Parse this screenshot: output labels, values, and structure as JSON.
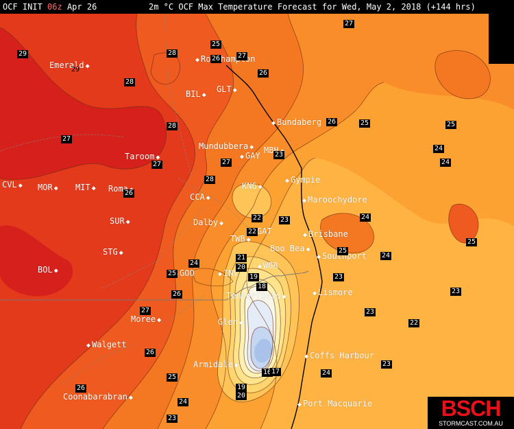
{
  "header": {
    "model": "OCF INIT",
    "run": "06z",
    "date": "Apr 26",
    "title": "2m °C OCF Max Temperature Forecast for Wed, May 2, 2018 (+144 hrs)"
  },
  "logo": {
    "text": "BSCH",
    "site": "STORMCAST.COM.AU"
  },
  "places": [
    {
      "id": "emerald",
      "name": "Emerald",
      "side": "left"
    },
    {
      "id": "rockhampton",
      "name": "Rockhampton",
      "side": "right"
    },
    {
      "id": "bil",
      "name": "BIL",
      "side": "left"
    },
    {
      "id": "glt",
      "name": "GLT",
      "side": "left"
    },
    {
      "id": "bundaberg",
      "name": "Bundaberg",
      "side": "right"
    },
    {
      "id": "mundubbera",
      "name": "Mundubbera",
      "side": "left"
    },
    {
      "id": "gay",
      "name": "GAY",
      "side": "right"
    },
    {
      "id": "mbh",
      "name": "MBH",
      "side": "left"
    },
    {
      "id": "taroom",
      "name": "Taroom",
      "side": "left"
    },
    {
      "id": "gympie",
      "name": "Gympie",
      "side": "right"
    },
    {
      "id": "kng",
      "name": "KNG",
      "side": "left"
    },
    {
      "id": "cvl",
      "name": "CVL",
      "side": "left"
    },
    {
      "id": "mor",
      "name": "MOR",
      "side": "left"
    },
    {
      "id": "mit",
      "name": "MIT",
      "side": "left"
    },
    {
      "id": "roma",
      "name": "Roma",
      "side": "left"
    },
    {
      "id": "cca",
      "name": "CCA",
      "side": "left"
    },
    {
      "id": "maroochydore",
      "name": "Maroochydore",
      "side": "right"
    },
    {
      "id": "sur",
      "name": "SUR",
      "side": "left"
    },
    {
      "id": "dalby",
      "name": "Dalby",
      "side": "left"
    },
    {
      "id": "gat",
      "name": "GAT",
      "side": "right"
    },
    {
      "id": "brisbane",
      "name": "Brisbane",
      "side": "right"
    },
    {
      "id": "twb",
      "name": "TWB",
      "side": "left"
    },
    {
      "id": "boobea",
      "name": "Boo Bea",
      "side": "left"
    },
    {
      "id": "stg",
      "name": "STG",
      "side": "left"
    },
    {
      "id": "southport",
      "name": "Southport",
      "side": "right"
    },
    {
      "id": "bol",
      "name": "BOL",
      "side": "left"
    },
    {
      "id": "goo",
      "name": "GOO",
      "side": "right"
    },
    {
      "id": "wor",
      "name": "WOR",
      "side": "right"
    },
    {
      "id": "inv",
      "name": "INV",
      "side": "right"
    },
    {
      "id": "tenterfield",
      "name": "Tenterfield",
      "side": "left"
    },
    {
      "id": "lismore",
      "name": "Lismore",
      "side": "right"
    },
    {
      "id": "moree",
      "name": "Moree",
      "side": "left"
    },
    {
      "id": "glen",
      "name": "Glen",
      "side": "left"
    },
    {
      "id": "walgett",
      "name": "Walgett",
      "side": "right"
    },
    {
      "id": "armidale",
      "name": "Armidale",
      "side": "left"
    },
    {
      "id": "coffsharbour",
      "name": "Coffs Harbour",
      "side": "right"
    },
    {
      "id": "coonabarabran",
      "name": "Coonabarabran",
      "side": "left"
    },
    {
      "id": "portmacquarie",
      "name": "Port Macquarie",
      "side": "right"
    }
  ],
  "labels": [
    {
      "v": "27",
      "style": "box"
    },
    {
      "v": "29",
      "style": "box"
    },
    {
      "v": "29",
      "style": "plain"
    },
    {
      "v": "28",
      "style": "box"
    },
    {
      "v": "25",
      "style": "box"
    },
    {
      "v": "27",
      "style": "box"
    },
    {
      "v": "26",
      "style": "box"
    },
    {
      "v": "26",
      "style": "box"
    },
    {
      "v": "28",
      "style": "box"
    },
    {
      "v": "28",
      "style": "box"
    },
    {
      "v": "26",
      "style": "box"
    },
    {
      "v": "25",
      "style": "box"
    },
    {
      "v": "25",
      "style": "box"
    },
    {
      "v": "27",
      "style": "box"
    },
    {
      "v": "24",
      "style": "box"
    },
    {
      "v": "24",
      "style": "box"
    },
    {
      "v": "27",
      "style": "box"
    },
    {
      "v": "27",
      "style": "box"
    },
    {
      "v": "23",
      "style": "box"
    },
    {
      "v": "26",
      "style": "box"
    },
    {
      "v": "28",
      "style": "box"
    },
    {
      "v": "22",
      "style": "box"
    },
    {
      "v": "23",
      "style": "box"
    },
    {
      "v": "24",
      "style": "box"
    },
    {
      "v": "25",
      "style": "box"
    },
    {
      "v": "22",
      "style": "box"
    },
    {
      "v": "21",
      "style": "box"
    },
    {
      "v": "25",
      "style": "box"
    },
    {
      "v": "24",
      "style": "box"
    },
    {
      "v": "24",
      "style": "box"
    },
    {
      "v": "20",
      "style": "box"
    },
    {
      "v": "25",
      "style": "box"
    },
    {
      "v": "19",
      "style": "box"
    },
    {
      "v": "23",
      "style": "box"
    },
    {
      "v": "26",
      "style": "box"
    },
    {
      "v": "18",
      "style": "box"
    },
    {
      "v": "23",
      "style": "box"
    },
    {
      "v": "23",
      "style": "box"
    },
    {
      "v": "27",
      "style": "box"
    },
    {
      "v": "22",
      "style": "box"
    },
    {
      "v": "26",
      "style": "box"
    },
    {
      "v": "16",
      "style": "box"
    },
    {
      "v": "17",
      "style": "box"
    },
    {
      "v": "23",
      "style": "box"
    },
    {
      "v": "25",
      "style": "box"
    },
    {
      "v": "24",
      "style": "box"
    },
    {
      "v": "26",
      "style": "box"
    },
    {
      "v": "19",
      "style": "box"
    },
    {
      "v": "20",
      "style": "box"
    },
    {
      "v": "24",
      "style": "box"
    },
    {
      "v": "23",
      "style": "box"
    }
  ],
  "colors": {
    "t29": "#d6201b",
    "t28": "#e33a1c",
    "t27": "#ee5a1f",
    "t26": "#f47722",
    "t25": "#f98d29",
    "t24": "#fca233",
    "t23": "#feb343",
    "t22": "#ffc457",
    "t21": "#ffd56f",
    "t20": "#ffe48c",
    "t19": "#fff1b1",
    "t18": "#f7f7e9",
    "t17": "#e4ecf8",
    "t16": "#c4d6f2",
    "t15": "#a9c2ea"
  }
}
